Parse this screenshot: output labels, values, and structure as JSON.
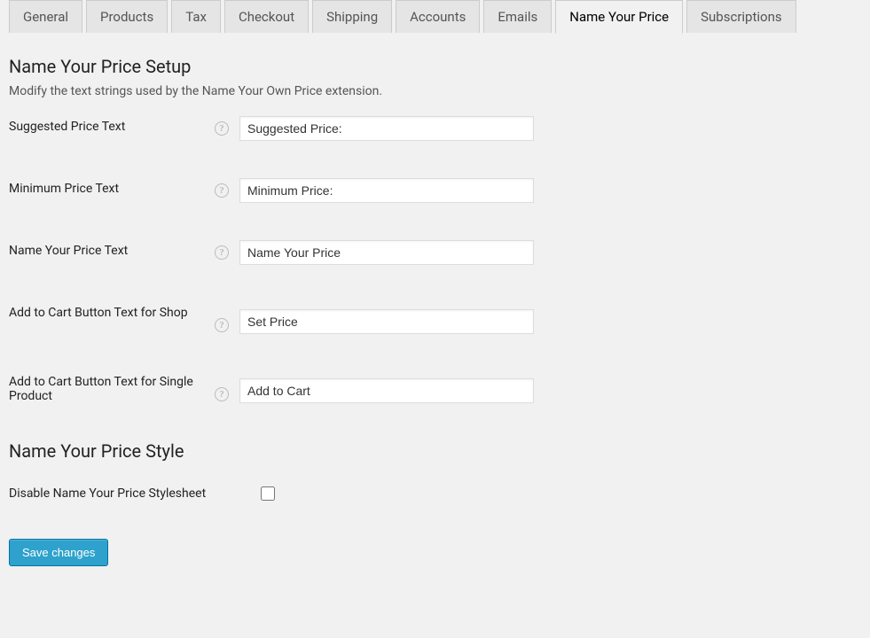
{
  "tabs": [
    {
      "label": "General",
      "active": false
    },
    {
      "label": "Products",
      "active": false
    },
    {
      "label": "Tax",
      "active": false
    },
    {
      "label": "Checkout",
      "active": false
    },
    {
      "label": "Shipping",
      "active": false
    },
    {
      "label": "Accounts",
      "active": false
    },
    {
      "label": "Emails",
      "active": false
    },
    {
      "label": "Name Your Price",
      "active": true
    },
    {
      "label": "Subscriptions",
      "active": false
    }
  ],
  "section1": {
    "heading": "Name Your Price Setup",
    "description": "Modify the text strings used by the Name Your Own Price extension.",
    "fields": {
      "suggested_price": {
        "label": "Suggested Price Text",
        "value": "Suggested Price:"
      },
      "minimum_price": {
        "label": "Minimum Price Text",
        "value": "Minimum Price:"
      },
      "name_your_price": {
        "label": "Name Your Price Text",
        "value": "Name Your Price"
      },
      "add_to_cart_shop": {
        "label": "Add to Cart Button Text for Shop",
        "value": "Set Price"
      },
      "add_to_cart_single": {
        "label": "Add to Cart Button Text for Single Product",
        "value": "Add to Cart"
      }
    }
  },
  "section2": {
    "heading": "Name Your Price Style",
    "disable_stylesheet": {
      "label": "Disable Name Your Price Stylesheet",
      "checked": false
    }
  },
  "save_label": "Save changes",
  "help_glyph": "?"
}
